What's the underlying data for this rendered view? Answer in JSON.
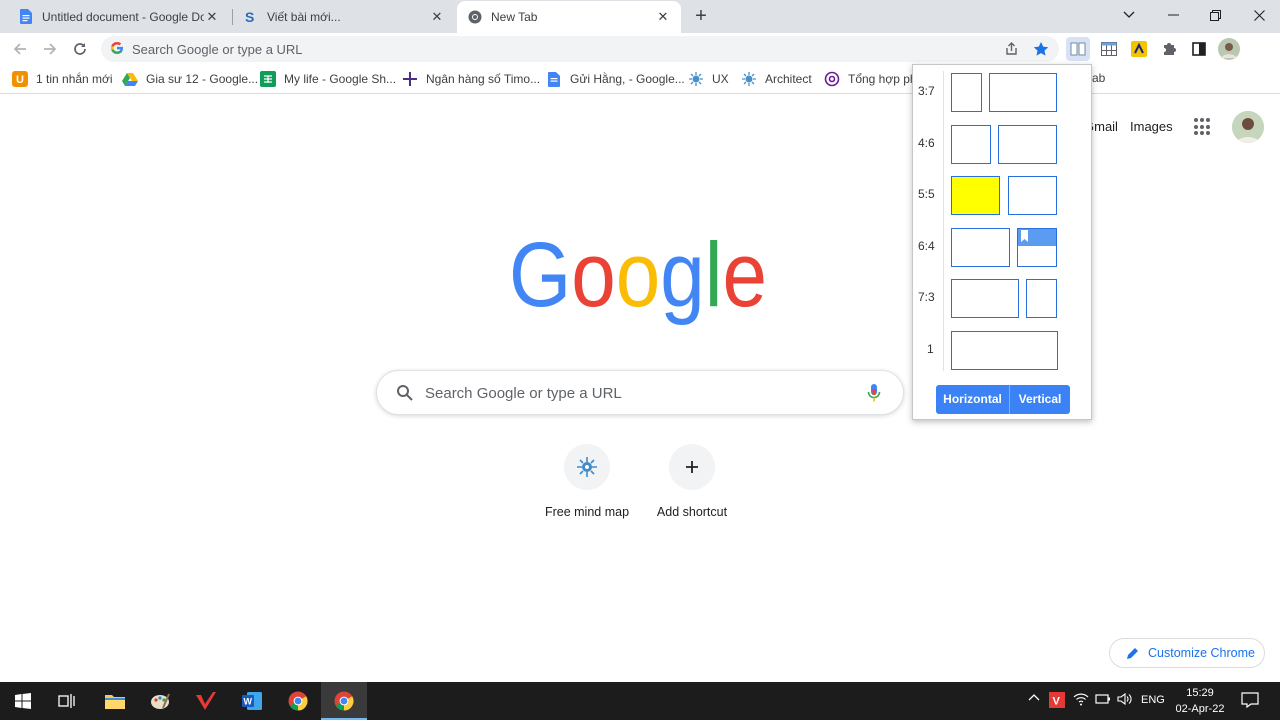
{
  "tabs": [
    {
      "title": "Untitled document - Google Doc",
      "icon": "google-docs-icon",
      "active": false
    },
    {
      "title": "Viết bài mới...",
      "icon": "s-logo-icon",
      "active": false
    },
    {
      "title": "New Tab",
      "icon": "chrome-icon",
      "active": true
    }
  ],
  "tab_close": "✕",
  "new_tab_button": "+",
  "window_controls": [
    "chevron-down-icon",
    "minimize-icon",
    "restore-icon",
    "close-icon"
  ],
  "omnibox": {
    "placeholder": "Search Google or type a URL"
  },
  "bookmarks": [
    {
      "label": "1 tin nhắn mới",
      "icon": "u-orange-icon"
    },
    {
      "label": "Gia sư 12 - Google...",
      "icon": "google-drive-icon"
    },
    {
      "label": "My life - Google Sh...",
      "icon": "google-sheets-icon"
    },
    {
      "label": "Ngân hàng số Timo...",
      "icon": "timo-icon"
    },
    {
      "label": "Gửi Hằng, - Google...",
      "icon": "google-docs-icon"
    },
    {
      "label": "UX",
      "icon": "mindmap-icon"
    },
    {
      "label": "Architect",
      "icon": "mindmap-icon"
    },
    {
      "label": "Tổng hợp phí",
      "icon": "at-icon"
    },
    {
      "label": "ab",
      "icon": ""
    }
  ],
  "ntp": {
    "gmail": "Gmail",
    "images": "Images",
    "search_placeholder": "Search Google or type a URL",
    "logo_text": "Google",
    "shortcuts": [
      {
        "label": "Free mind map",
        "icon": "mindmap-icon"
      },
      {
        "label": "Add shortcut",
        "icon": "plus-icon"
      }
    ],
    "customize": "Customize Chrome"
  },
  "popup": {
    "ratios": [
      "3:7",
      "4:6",
      "5:5",
      "6:4",
      "7:3",
      "1"
    ],
    "selected_ratio": "5:5",
    "buttons": [
      "Horizontal",
      "Vertical"
    ],
    "highlight_color": "#ffff00",
    "accent_color": "#3b82f6"
  },
  "taskbar": {
    "language": "ENG",
    "time": "15:29",
    "date": "02-Apr-22"
  }
}
